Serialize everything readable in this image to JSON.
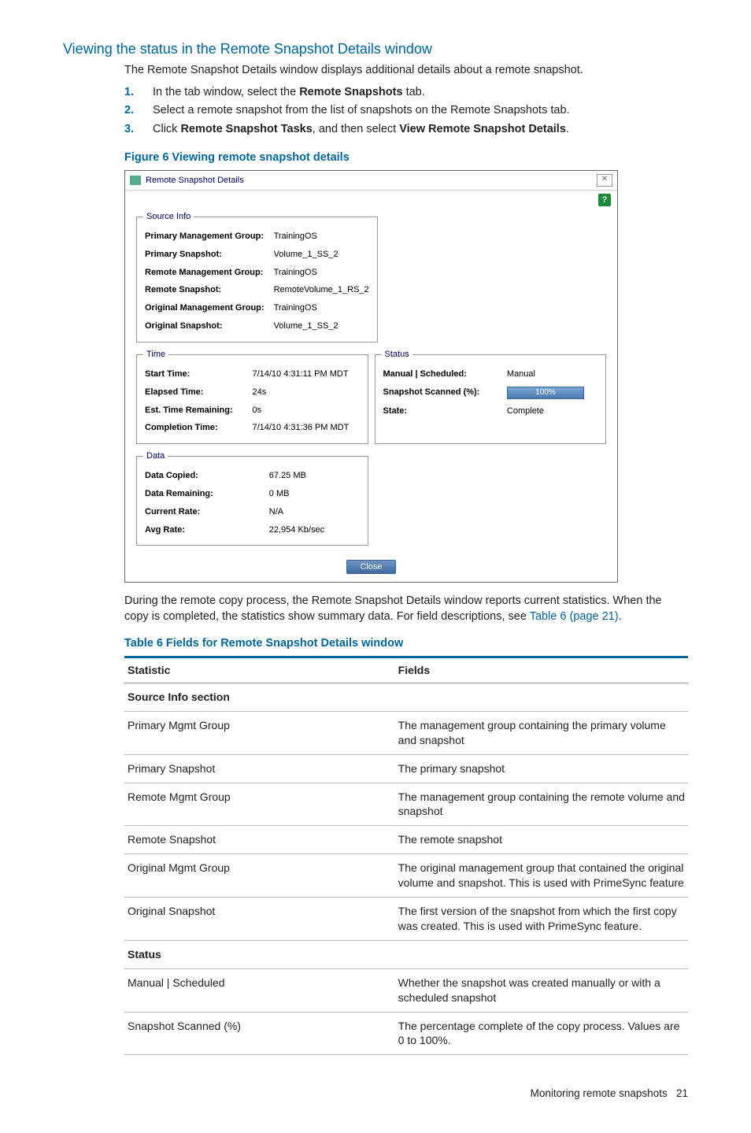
{
  "heading": "Viewing the status in the Remote Snapshot Details window",
  "intro": "The Remote Snapshot Details window displays additional details about a remote snapshot.",
  "steps": [
    {
      "pre": "In the tab window, select the ",
      "b1": "Remote Snapshots",
      "post": " tab."
    },
    {
      "pre": "Select a remote snapshot from the list of snapshots on the Remote Snapshots tab.",
      "b1": "",
      "post": ""
    },
    {
      "pre": "Click ",
      "b1": "Remote Snapshot Tasks",
      "mid": ", and then select ",
      "b2": "View Remote Snapshot Details",
      "post": "."
    }
  ],
  "figure_caption": "Figure 6 Viewing remote snapshot details",
  "dialog": {
    "title": "Remote Snapshot Details",
    "help": "?",
    "source": {
      "legend": "Source Info",
      "rows": [
        {
          "k": "Primary Management Group:",
          "v": "TrainingOS"
        },
        {
          "k": "Primary Snapshot:",
          "v": "Volume_1_SS_2"
        },
        {
          "k": "Remote Management Group:",
          "v": "TrainingOS"
        },
        {
          "k": "Remote Snapshot:",
          "v": "RemoteVolume_1_RS_2"
        },
        {
          "k": "Original Management Group:",
          "v": "TrainingOS"
        },
        {
          "k": "Original Snapshot:",
          "v": "Volume_1_SS_2"
        }
      ]
    },
    "time": {
      "legend": "Time",
      "rows": [
        {
          "k": "Start Time:",
          "v": "7/14/10 4:31:11 PM MDT"
        },
        {
          "k": "Elapsed Time:",
          "v": "24s"
        },
        {
          "k": "Est. Time Remaining:",
          "v": "0s"
        },
        {
          "k": "Completion Time:",
          "v": "7/14/10 4:31:36 PM MDT"
        }
      ]
    },
    "status": {
      "legend": "Status",
      "rows": [
        {
          "k": "Manual | Scheduled:",
          "v": "Manual"
        },
        {
          "k": "Snapshot Scanned (%):",
          "v": "100%",
          "progress": true
        },
        {
          "k": "State:",
          "v": "Complete"
        }
      ]
    },
    "data": {
      "legend": "Data",
      "rows": [
        {
          "k": "Data Copied:",
          "v": "67.25 MB"
        },
        {
          "k": "Data Remaining:",
          "v": "0 MB"
        },
        {
          "k": "Current Rate:",
          "v": "N/A"
        },
        {
          "k": "Avg Rate:",
          "v": "22,954 Kb/sec"
        }
      ]
    },
    "close_btn": "Close"
  },
  "para2_a": "During the remote copy process, the Remote Snapshot Details window reports current statistics. When the copy is completed, the statistics show summary data. For field descriptions, see ",
  "para2_link": "Table 6 (page 21)",
  "para2_b": ".",
  "table_caption": "Table 6 Fields for Remote Snapshot Details window",
  "table": {
    "h1": "Statistic",
    "h2": "Fields",
    "rows": [
      {
        "section": true,
        "c1": "Source Info section",
        "c2": ""
      },
      {
        "c1": "Primary Mgmt Group",
        "c2": "The management group containing the primary volume and snapshot"
      },
      {
        "c1": "Primary Snapshot",
        "c2": "The primary snapshot"
      },
      {
        "c1": "Remote Mgmt Group",
        "c2": "The management group containing the remote volume and snapshot"
      },
      {
        "c1": "Remote Snapshot",
        "c2": "The remote snapshot"
      },
      {
        "c1": "Original Mgmt Group",
        "c2": "The original management group that contained the original volume and snapshot. This is used with PrimeSync feature"
      },
      {
        "c1": "Original Snapshot",
        "c2": "The first version of the snapshot from which the first copy was created. This is used with PrimeSync feature."
      },
      {
        "section": true,
        "c1": "Status",
        "c2": ""
      },
      {
        "c1": "Manual | Scheduled",
        "c2": "Whether the snapshot was created manually or with a scheduled snapshot"
      },
      {
        "c1": "Snapshot Scanned (%)",
        "c2": "The percentage complete of the copy process. Values are 0 to 100%."
      }
    ]
  },
  "footer_text": "Monitoring remote snapshots",
  "footer_page": "21"
}
